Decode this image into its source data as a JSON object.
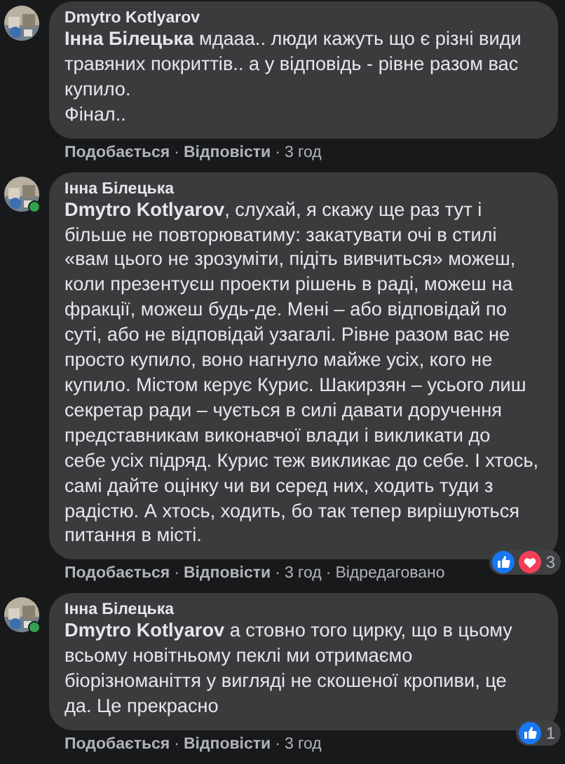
{
  "separator": "·",
  "comments": [
    {
      "author": "Dmytro Kotlyarov",
      "online": false,
      "mention": "Інна Білецька",
      "paragraphs": [
        "мдааа.. люди кажуть що є різні види\nтравяних покриттів.. а у відповідь - рівне разом вас\nкупило.",
        "Фінал.."
      ],
      "actions": [
        "Подобається",
        "Відповісти"
      ],
      "time": "3 год"
    },
    {
      "author": "Інна Білецька",
      "online": true,
      "mention": "Dmytro Kotlyarov",
      "paragraphs": [
        ", слухай, я скажу ще раз тут і\nбільше не повторюватиму: закатувати очі в стилі\n«вам цього не зрозуміти, підіть вивчиться» можеш,\nколи презентуєш проекти рішень в раді, можеш на\nфракції, можеш будь-де. Мені – або відповідай по\nсуті, або не відповідай узагалі. Рівне разом вас не\nпросто купило, воно нагнуло майже усіх, кого не\nкупило. Містом керує Курис. Шакирзян – усього лиш\nсекретар ради – чується в силі давати доручення\nпредставникам виконавчої влади і викликати до\nсебе усіх підряд. Курис теж викликає до себе. І хтось,\nсамі дайте оцінку чи ви серед них, ходить туди з\nрадістю. А хтось, ходить, бо так тепер вирішуються\nпитання в місті."
      ],
      "actions": [
        "Подобається",
        "Відповісти"
      ],
      "time": "3 год",
      "edited": "Відредаговано",
      "reactions": [
        {
          "kind": "like"
        },
        {
          "kind": "love"
        }
      ],
      "reaction_count": "3"
    },
    {
      "author": "Інна Білецька",
      "online": true,
      "mention": "Dmytro Kotlyarov",
      "paragraphs": [
        "а стовно того цирку, що в цьому\nвсьому новітньому пеклі ми отримаємо\nбіорізноманіття у вигляді не скошеної кропиви, це\nда. Це прекрасно"
      ],
      "actions": [
        "Подобається",
        "Відповісти"
      ],
      "time": "3 год",
      "reactions": [
        {
          "kind": "like"
        }
      ],
      "reaction_count": "1"
    }
  ]
}
